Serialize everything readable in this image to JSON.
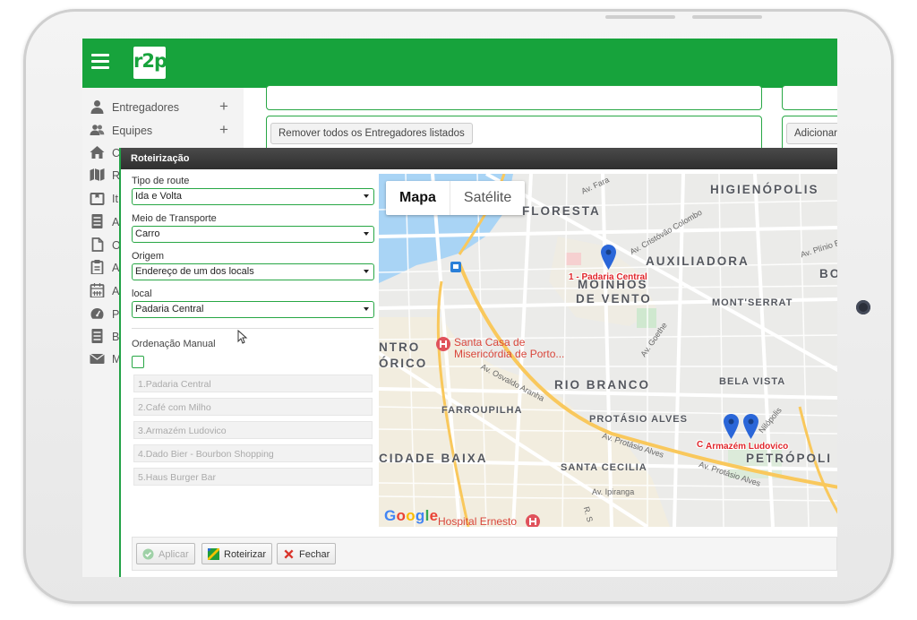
{
  "app": {
    "logo_text": "r2p"
  },
  "sidebar": {
    "items": [
      {
        "label": "Entregadores",
        "icon": "user-icon",
        "has_plus": true
      },
      {
        "label": "Equipes",
        "icon": "users-icon",
        "has_plus": true
      },
      {
        "label": "C",
        "icon": "home-icon",
        "has_plus": false
      },
      {
        "label": "R",
        "icon": "map-icon",
        "has_plus": false
      },
      {
        "label": "It",
        "icon": "package-icon",
        "has_plus": false
      },
      {
        "label": "A",
        "icon": "list-icon",
        "has_plus": false
      },
      {
        "label": "O",
        "icon": "file-icon",
        "has_plus": false
      },
      {
        "label": "A",
        "icon": "clipboard-icon",
        "has_plus": false
      },
      {
        "label": "A",
        "icon": "calendar-icon",
        "has_plus": false
      },
      {
        "label": "P",
        "icon": "dashboard-icon",
        "has_plus": false
      },
      {
        "label": "B",
        "icon": "list-icon",
        "has_plus": false
      },
      {
        "label": "M",
        "icon": "envelope-icon",
        "has_plus": false
      }
    ]
  },
  "background": {
    "remove_button": "Remover todos os Entregadores listados",
    "add_button": "Adicionar"
  },
  "dialog": {
    "title": "Roteirização",
    "form": {
      "route_type_label": "Tipo de route",
      "route_type_value": "Ida e Volta",
      "transport_label": "Meio de Transporte",
      "transport_value": "Carro",
      "origin_label": "Origem",
      "origin_value": "Endereço de um dos locals",
      "local_label": "local",
      "local_value": "Padaria Central"
    },
    "ordering": {
      "label": "Ordenação Manual",
      "checked": false,
      "items": [
        "1.Padaria Central",
        "2.Café com Milho",
        "3.Armazém Ludovico",
        "4.Dado Bier - Bourbon Shopping",
        "5.Haus Burger Bar"
      ]
    },
    "map": {
      "type_map": "Mapa",
      "type_satellite": "Satélite",
      "districts": {
        "floresta": "FLORESTA",
        "higienopolis": "HIGIENÓPOLIS",
        "auxiliadora": "AUXILIADORA",
        "bo": "BO",
        "moinhos_1": "MOINHOS",
        "moinhos_2": "DE VENTO",
        "montserrat": "MONT'SERRAT",
        "centro_1": "NTRO",
        "centro_2": "ÓRICO",
        "rio_branco": "RIO BRANCO",
        "bela_vista": "BELA VISTA",
        "farroupilha": "FARROUPILHA",
        "protasio_alves": "PROTÁSIO ALVES",
        "cidade_baixa": "CIDADE BAIXA",
        "petropolis": "PETRÓPOLI",
        "santa_cecilia": "SANTA CECILIA"
      },
      "streets": {
        "osvaldo_aranha": "Av. Osvaldo Aranha",
        "protasio_1": "Av. Protásio Alves",
        "protasio_2": "Av. Protásio Alves",
        "ipiranga": "Av. Ipiranga",
        "goethe": "Av. Goethe",
        "plinio": "Av. Plínio Br",
        "farrapos": "Av. Fara",
        "cristovao": "Av. Cristóvão Colombo",
        "nilopolis": "Nilópolis",
        "r_s": "R. S"
      },
      "pois": {
        "santa_casa_1": "Santa Casa de",
        "santa_casa_2": "Misericórdia de Porto...",
        "hospital": "Hospital Ernesto"
      },
      "markers": [
        {
          "label": "1 - Padaria Central"
        },
        {
          "label": "C"
        },
        {
          "label": "Armazém Ludovico"
        }
      ],
      "google_logo": "Google"
    },
    "footer": {
      "apply": "Aplicar",
      "route": "Roteirizar",
      "close": "Fechar"
    }
  },
  "colors": {
    "brand_green": "#17a33c",
    "marker_blue": "#2a66d8",
    "label_red": "#e0262b",
    "close_red": "#d9342b"
  }
}
